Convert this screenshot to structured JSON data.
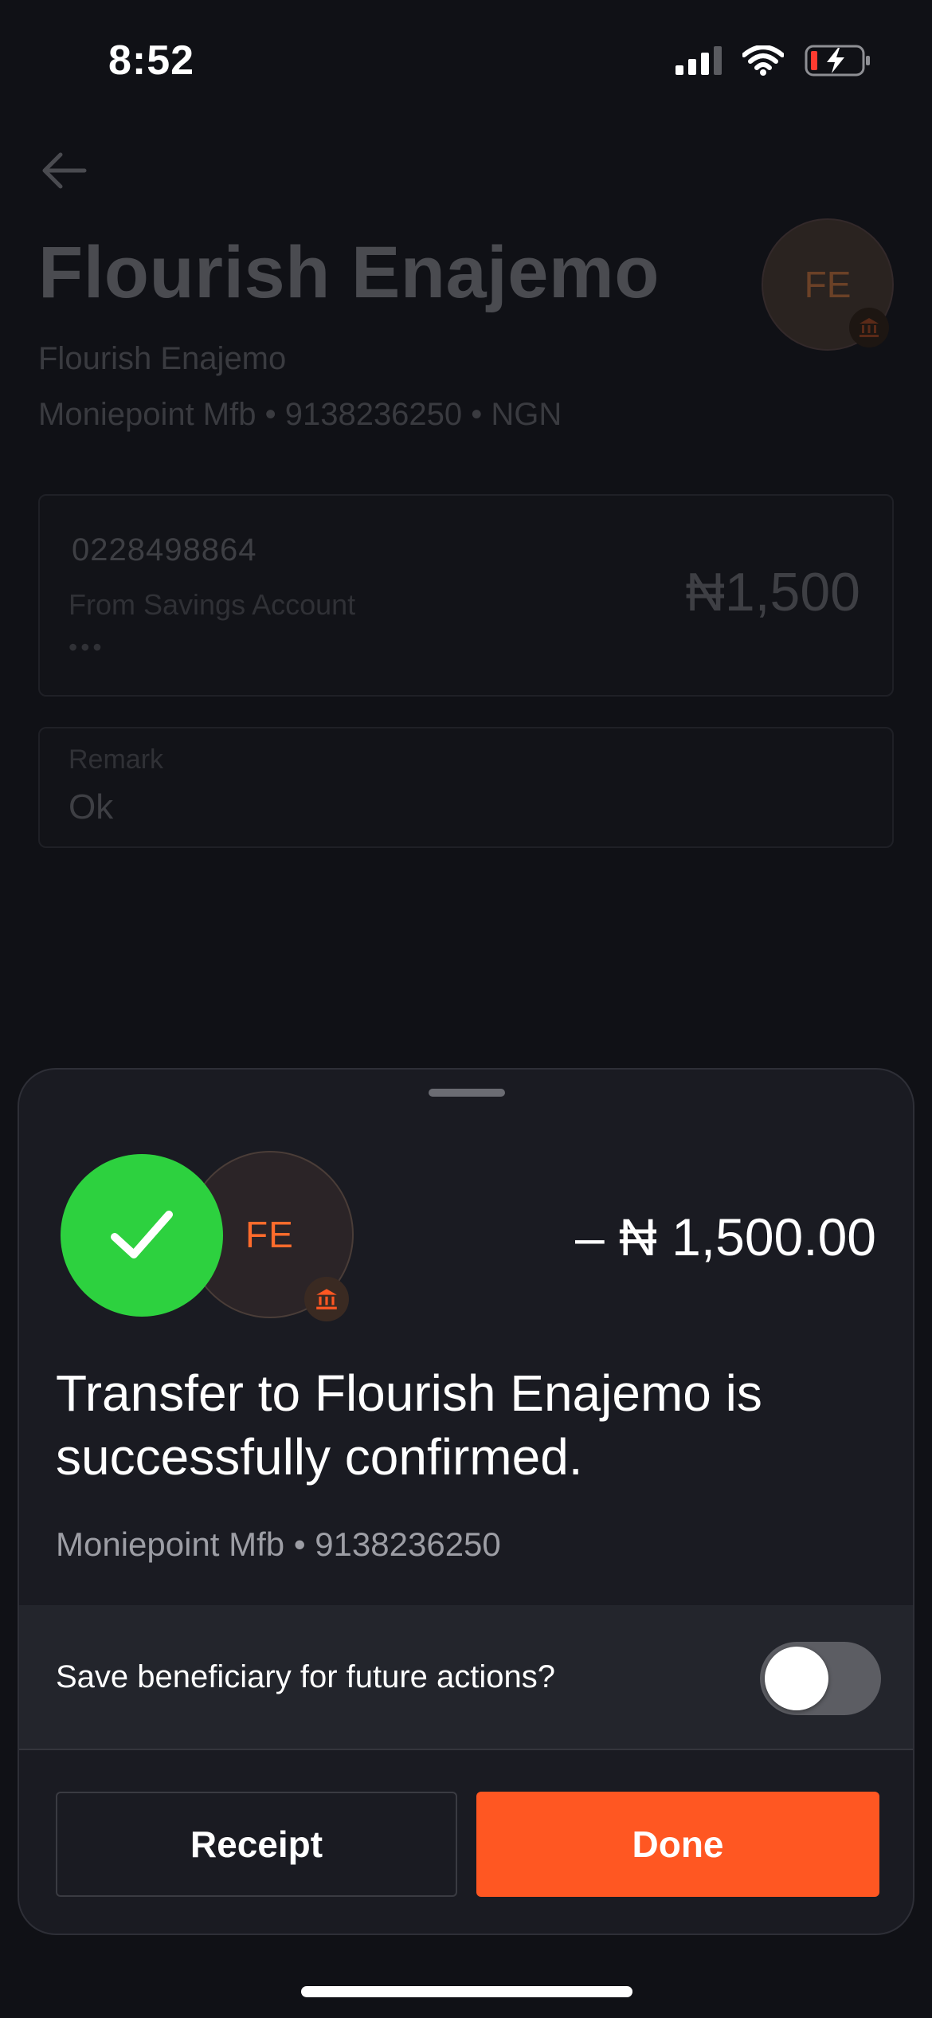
{
  "status_bar": {
    "time": "8:52",
    "icons": [
      "cellular-signal-icon",
      "wifi-icon",
      "battery-charging-icon"
    ]
  },
  "background_screen": {
    "back_icon": "arrow-left-icon",
    "title": "Flourish Enajemo",
    "subtitle": "Flourish Enajemo",
    "bank_line": "Moniepoint Mfb • 9138236250 • NGN",
    "avatar_initials": "FE",
    "avatar_badge_icon": "bank-icon",
    "account_number": "0228498864",
    "account_source": "From Savings Account",
    "account_masked": "•••",
    "amount": "₦1,500",
    "remark_label": "Remark",
    "remark_value": "Ok"
  },
  "sheet": {
    "success_icon": "checkmark-icon",
    "avatar_initials": "FE",
    "avatar_badge_icon": "bank-icon",
    "amount": "– ₦ 1,500.00",
    "message": "Transfer to Flourish Enajemo is successfully confirmed.",
    "bank_line": "Moniepoint Mfb • 9138236250",
    "save_beneficiary_label": "Save beneficiary for future actions?",
    "save_beneficiary_on": false,
    "receipt_label": "Receipt",
    "done_label": "Done"
  },
  "colors": {
    "background": "#101116",
    "sheet": "#1a1b22",
    "success": "#2dd13f",
    "accent": "#ff5722",
    "initials": "#ff6b2c"
  }
}
